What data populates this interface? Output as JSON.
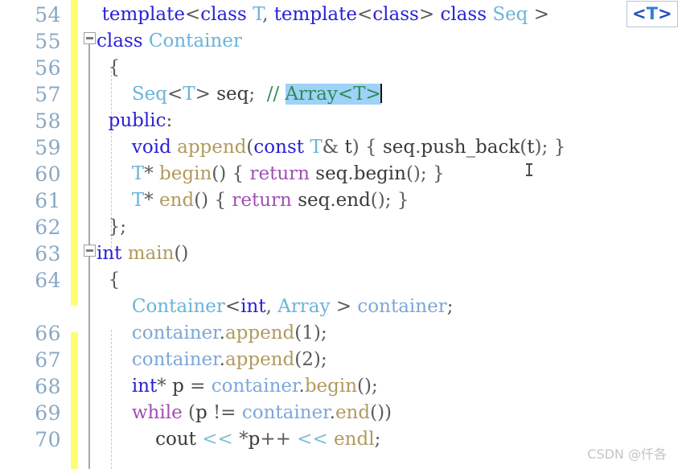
{
  "editor": {
    "language": "C++",
    "colors": {
      "background": "#ffffff",
      "line_number": "#87a8c4",
      "change_bar_yellow": "#fdfd72",
      "keyword_blue": "#2a21d6",
      "control_purple": "#a24fb4",
      "type_cyan": "#6ab4d8",
      "function_tan": "#b09a5e",
      "comment_green": "#2e8b57",
      "selection_blue": "#9fd2f7",
      "object_lightblue": "#7da7d9",
      "fold_gray": "#a8a8a8"
    },
    "line_numbers": [
      "54",
      "55",
      "56",
      "57",
      "58",
      "59",
      "60",
      "61",
      "62",
      "63",
      "64",
      "",
      "66",
      "67",
      "68",
      "69",
      "70"
    ],
    "lines": [
      {
        "number": "54",
        "text": "  template<class T, template<class> class Seq >",
        "tokens": [
          {
            "t": "  ",
            "c": "punc"
          },
          {
            "t": "template",
            "c": "kw"
          },
          {
            "t": "<",
            "c": "punc"
          },
          {
            "t": "class",
            "c": "kw"
          },
          {
            "t": " ",
            "c": "punc"
          },
          {
            "t": "T",
            "c": "type"
          },
          {
            "t": ", ",
            "c": "punc"
          },
          {
            "t": "template",
            "c": "kw"
          },
          {
            "t": "<",
            "c": "punc"
          },
          {
            "t": "class",
            "c": "kw"
          },
          {
            "t": "> ",
            "c": "punc"
          },
          {
            "t": "class",
            "c": "kw"
          },
          {
            "t": " ",
            "c": "punc"
          },
          {
            "t": "Seq",
            "c": "type"
          },
          {
            "t": " >",
            "c": "punc"
          }
        ]
      },
      {
        "number": "55",
        "text": "class Container",
        "tokens": [
          {
            "t": "class",
            "c": "kw"
          },
          {
            "t": " ",
            "c": "punc"
          },
          {
            "t": "Container",
            "c": "type"
          }
        ]
      },
      {
        "number": "56",
        "text": "  {",
        "tokens": [
          {
            "t": "  {",
            "c": "punc"
          }
        ]
      },
      {
        "number": "57",
        "text": "      Seq<T> seq;  // Array<T>",
        "tokens": [
          {
            "t": "      ",
            "c": "punc"
          },
          {
            "t": "Seq",
            "c": "type"
          },
          {
            "t": "<",
            "c": "punc"
          },
          {
            "t": "T",
            "c": "type"
          },
          {
            "t": "> ",
            "c": "punc"
          },
          {
            "t": "seq",
            "c": "ident"
          },
          {
            "t": ";  ",
            "c": "punc"
          },
          {
            "t": "// ",
            "c": "cmt"
          },
          {
            "t": "Array<T>",
            "c": "sel"
          }
        ]
      },
      {
        "number": "58",
        "text": "  public:",
        "tokens": [
          {
            "t": "  ",
            "c": "punc"
          },
          {
            "t": "public",
            "c": "kw"
          },
          {
            "t": ":",
            "c": "punc"
          }
        ]
      },
      {
        "number": "59",
        "text": "      void append(const T& t) { seq.push_back(t); }",
        "tokens": [
          {
            "t": "      ",
            "c": "punc"
          },
          {
            "t": "void",
            "c": "kw"
          },
          {
            "t": " ",
            "c": "punc"
          },
          {
            "t": "append",
            "c": "fn"
          },
          {
            "t": "(",
            "c": "punc"
          },
          {
            "t": "const",
            "c": "kw"
          },
          {
            "t": " ",
            "c": "punc"
          },
          {
            "t": "T",
            "c": "type"
          },
          {
            "t": "& ",
            "c": "punc"
          },
          {
            "t": "t",
            "c": "ident"
          },
          {
            "t": ") { ",
            "c": "punc"
          },
          {
            "t": "seq",
            "c": "ident"
          },
          {
            "t": ".",
            "c": "punc"
          },
          {
            "t": "push_back",
            "c": "ident"
          },
          {
            "t": "(",
            "c": "punc"
          },
          {
            "t": "t",
            "c": "ident"
          },
          {
            "t": "); }",
            "c": "punc"
          }
        ]
      },
      {
        "number": "60",
        "text": "      T* begin() { return seq.begin(); }",
        "tokens": [
          {
            "t": "      ",
            "c": "punc"
          },
          {
            "t": "T",
            "c": "type"
          },
          {
            "t": "* ",
            "c": "punc"
          },
          {
            "t": "begin",
            "c": "fn"
          },
          {
            "t": "() { ",
            "c": "punc"
          },
          {
            "t": "return",
            "c": "ctrl"
          },
          {
            "t": " ",
            "c": "punc"
          },
          {
            "t": "seq",
            "c": "ident"
          },
          {
            "t": ".",
            "c": "punc"
          },
          {
            "t": "begin",
            "c": "ident"
          },
          {
            "t": "(); }",
            "c": "punc"
          }
        ]
      },
      {
        "number": "61",
        "text": "      T* end() { return seq.end(); }",
        "tokens": [
          {
            "t": "      ",
            "c": "punc"
          },
          {
            "t": "T",
            "c": "type"
          },
          {
            "t": "* ",
            "c": "punc"
          },
          {
            "t": "end",
            "c": "fn"
          },
          {
            "t": "() { ",
            "c": "punc"
          },
          {
            "t": "return",
            "c": "ctrl"
          },
          {
            "t": " ",
            "c": "punc"
          },
          {
            "t": "seq",
            "c": "ident"
          },
          {
            "t": ".",
            "c": "punc"
          },
          {
            "t": "end",
            "c": "ident"
          },
          {
            "t": "(); }",
            "c": "punc"
          }
        ]
      },
      {
        "number": "62",
        "text": "  };",
        "tokens": [
          {
            "t": "  };",
            "c": "punc"
          }
        ]
      },
      {
        "number": "63",
        "text": "int main()",
        "tokens": [
          {
            "t": "int",
            "c": "kw"
          },
          {
            "t": " ",
            "c": "punc"
          },
          {
            "t": "main",
            "c": "fn"
          },
          {
            "t": "()",
            "c": "punc"
          }
        ]
      },
      {
        "number": "64",
        "text": "  {",
        "tokens": [
          {
            "t": "  {",
            "c": "punc"
          }
        ]
      },
      {
        "number": "",
        "text": "      Container<int, Array > container;",
        "tokens": [
          {
            "t": "      ",
            "c": "punc"
          },
          {
            "t": "Container",
            "c": "type"
          },
          {
            "t": "<",
            "c": "punc"
          },
          {
            "t": "int",
            "c": "kw"
          },
          {
            "t": ", ",
            "c": "punc"
          },
          {
            "t": "Array",
            "c": "type"
          },
          {
            "t": " > ",
            "c": "punc"
          },
          {
            "t": "container",
            "c": "obj"
          },
          {
            "t": ";",
            "c": "punc"
          }
        ]
      },
      {
        "number": "66",
        "text": "      container.append(1);",
        "tokens": [
          {
            "t": "      ",
            "c": "punc"
          },
          {
            "t": "container",
            "c": "obj"
          },
          {
            "t": ".",
            "c": "punc"
          },
          {
            "t": "append",
            "c": "fn"
          },
          {
            "t": "(1);",
            "c": "punc"
          }
        ]
      },
      {
        "number": "67",
        "text": "      container.append(2);",
        "tokens": [
          {
            "t": "      ",
            "c": "punc"
          },
          {
            "t": "container",
            "c": "obj"
          },
          {
            "t": ".",
            "c": "punc"
          },
          {
            "t": "append",
            "c": "fn"
          },
          {
            "t": "(2);",
            "c": "punc"
          }
        ]
      },
      {
        "number": "68",
        "text": "      int* p = container.begin();",
        "tokens": [
          {
            "t": "      ",
            "c": "punc"
          },
          {
            "t": "int",
            "c": "kw"
          },
          {
            "t": "* ",
            "c": "punc"
          },
          {
            "t": "p",
            "c": "ident"
          },
          {
            "t": " = ",
            "c": "punc"
          },
          {
            "t": "container",
            "c": "obj"
          },
          {
            "t": ".",
            "c": "punc"
          },
          {
            "t": "begin",
            "c": "fn"
          },
          {
            "t": "();",
            "c": "punc"
          }
        ]
      },
      {
        "number": "69",
        "text": "      while (p != container.end())",
        "tokens": [
          {
            "t": "      ",
            "c": "punc"
          },
          {
            "t": "while",
            "c": "ctrl"
          },
          {
            "t": " (",
            "c": "punc"
          },
          {
            "t": "p",
            "c": "ident"
          },
          {
            "t": " != ",
            "c": "punc"
          },
          {
            "t": "container",
            "c": "obj"
          },
          {
            "t": ".",
            "c": "punc"
          },
          {
            "t": "end",
            "c": "fn"
          },
          {
            "t": "())",
            "c": "punc"
          }
        ]
      },
      {
        "number": "70",
        "text": "          cout << *p++ << endl;",
        "tokens": [
          {
            "t": "          ",
            "c": "punc"
          },
          {
            "t": "cout",
            "c": "ident"
          },
          {
            "t": " ",
            "c": "punc"
          },
          {
            "t": "<<",
            "c": "op"
          },
          {
            "t": " *",
            "c": "punc"
          },
          {
            "t": "p",
            "c": "ident"
          },
          {
            "t": "++ ",
            "c": "punc"
          },
          {
            "t": "<<",
            "c": "op"
          },
          {
            "t": " ",
            "c": "punc"
          },
          {
            "t": "endl",
            "c": "fn"
          },
          {
            "t": ";",
            "c": "punc"
          }
        ]
      }
    ],
    "selection": {
      "text": "Array<T>",
      "line": "57"
    },
    "tooltip": {
      "open": "<",
      "letter": "T",
      "close": ">",
      "full": "<T>"
    },
    "fold_markers": [
      {
        "line": "55",
        "state": "expanded",
        "glyph": "minus"
      },
      {
        "line": "63",
        "state": "expanded",
        "glyph": "minus"
      }
    ],
    "watermark": "CSDN @仟各"
  }
}
